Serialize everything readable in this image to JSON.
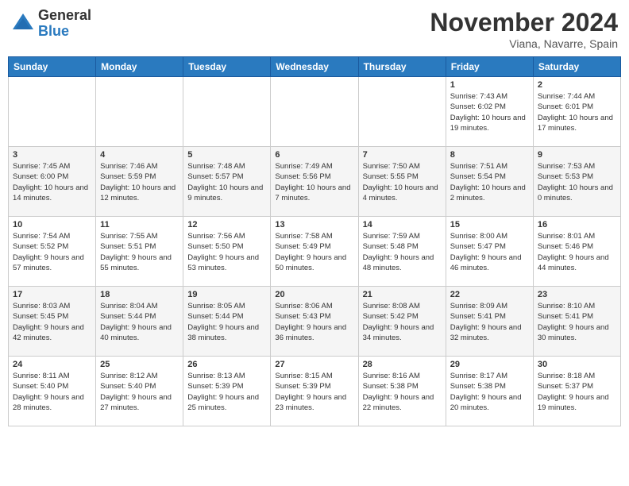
{
  "header": {
    "logo_general": "General",
    "logo_blue": "Blue",
    "month_title": "November 2024",
    "location": "Viana, Navarre, Spain"
  },
  "days_of_week": [
    "Sunday",
    "Monday",
    "Tuesday",
    "Wednesday",
    "Thursday",
    "Friday",
    "Saturday"
  ],
  "weeks": [
    [
      {
        "day": "",
        "info": ""
      },
      {
        "day": "",
        "info": ""
      },
      {
        "day": "",
        "info": ""
      },
      {
        "day": "",
        "info": ""
      },
      {
        "day": "",
        "info": ""
      },
      {
        "day": "1",
        "info": "Sunrise: 7:43 AM\nSunset: 6:02 PM\nDaylight: 10 hours and 19 minutes."
      },
      {
        "day": "2",
        "info": "Sunrise: 7:44 AM\nSunset: 6:01 PM\nDaylight: 10 hours and 17 minutes."
      }
    ],
    [
      {
        "day": "3",
        "info": "Sunrise: 7:45 AM\nSunset: 6:00 PM\nDaylight: 10 hours and 14 minutes."
      },
      {
        "day": "4",
        "info": "Sunrise: 7:46 AM\nSunset: 5:59 PM\nDaylight: 10 hours and 12 minutes."
      },
      {
        "day": "5",
        "info": "Sunrise: 7:48 AM\nSunset: 5:57 PM\nDaylight: 10 hours and 9 minutes."
      },
      {
        "day": "6",
        "info": "Sunrise: 7:49 AM\nSunset: 5:56 PM\nDaylight: 10 hours and 7 minutes."
      },
      {
        "day": "7",
        "info": "Sunrise: 7:50 AM\nSunset: 5:55 PM\nDaylight: 10 hours and 4 minutes."
      },
      {
        "day": "8",
        "info": "Sunrise: 7:51 AM\nSunset: 5:54 PM\nDaylight: 10 hours and 2 minutes."
      },
      {
        "day": "9",
        "info": "Sunrise: 7:53 AM\nSunset: 5:53 PM\nDaylight: 10 hours and 0 minutes."
      }
    ],
    [
      {
        "day": "10",
        "info": "Sunrise: 7:54 AM\nSunset: 5:52 PM\nDaylight: 9 hours and 57 minutes."
      },
      {
        "day": "11",
        "info": "Sunrise: 7:55 AM\nSunset: 5:51 PM\nDaylight: 9 hours and 55 minutes."
      },
      {
        "day": "12",
        "info": "Sunrise: 7:56 AM\nSunset: 5:50 PM\nDaylight: 9 hours and 53 minutes."
      },
      {
        "day": "13",
        "info": "Sunrise: 7:58 AM\nSunset: 5:49 PM\nDaylight: 9 hours and 50 minutes."
      },
      {
        "day": "14",
        "info": "Sunrise: 7:59 AM\nSunset: 5:48 PM\nDaylight: 9 hours and 48 minutes."
      },
      {
        "day": "15",
        "info": "Sunrise: 8:00 AM\nSunset: 5:47 PM\nDaylight: 9 hours and 46 minutes."
      },
      {
        "day": "16",
        "info": "Sunrise: 8:01 AM\nSunset: 5:46 PM\nDaylight: 9 hours and 44 minutes."
      }
    ],
    [
      {
        "day": "17",
        "info": "Sunrise: 8:03 AM\nSunset: 5:45 PM\nDaylight: 9 hours and 42 minutes."
      },
      {
        "day": "18",
        "info": "Sunrise: 8:04 AM\nSunset: 5:44 PM\nDaylight: 9 hours and 40 minutes."
      },
      {
        "day": "19",
        "info": "Sunrise: 8:05 AM\nSunset: 5:44 PM\nDaylight: 9 hours and 38 minutes."
      },
      {
        "day": "20",
        "info": "Sunrise: 8:06 AM\nSunset: 5:43 PM\nDaylight: 9 hours and 36 minutes."
      },
      {
        "day": "21",
        "info": "Sunrise: 8:08 AM\nSunset: 5:42 PM\nDaylight: 9 hours and 34 minutes."
      },
      {
        "day": "22",
        "info": "Sunrise: 8:09 AM\nSunset: 5:41 PM\nDaylight: 9 hours and 32 minutes."
      },
      {
        "day": "23",
        "info": "Sunrise: 8:10 AM\nSunset: 5:41 PM\nDaylight: 9 hours and 30 minutes."
      }
    ],
    [
      {
        "day": "24",
        "info": "Sunrise: 8:11 AM\nSunset: 5:40 PM\nDaylight: 9 hours and 28 minutes."
      },
      {
        "day": "25",
        "info": "Sunrise: 8:12 AM\nSunset: 5:40 PM\nDaylight: 9 hours and 27 minutes."
      },
      {
        "day": "26",
        "info": "Sunrise: 8:13 AM\nSunset: 5:39 PM\nDaylight: 9 hours and 25 minutes."
      },
      {
        "day": "27",
        "info": "Sunrise: 8:15 AM\nSunset: 5:39 PM\nDaylight: 9 hours and 23 minutes."
      },
      {
        "day": "28",
        "info": "Sunrise: 8:16 AM\nSunset: 5:38 PM\nDaylight: 9 hours and 22 minutes."
      },
      {
        "day": "29",
        "info": "Sunrise: 8:17 AM\nSunset: 5:38 PM\nDaylight: 9 hours and 20 minutes."
      },
      {
        "day": "30",
        "info": "Sunrise: 8:18 AM\nSunset: 5:37 PM\nDaylight: 9 hours and 19 minutes."
      }
    ]
  ]
}
